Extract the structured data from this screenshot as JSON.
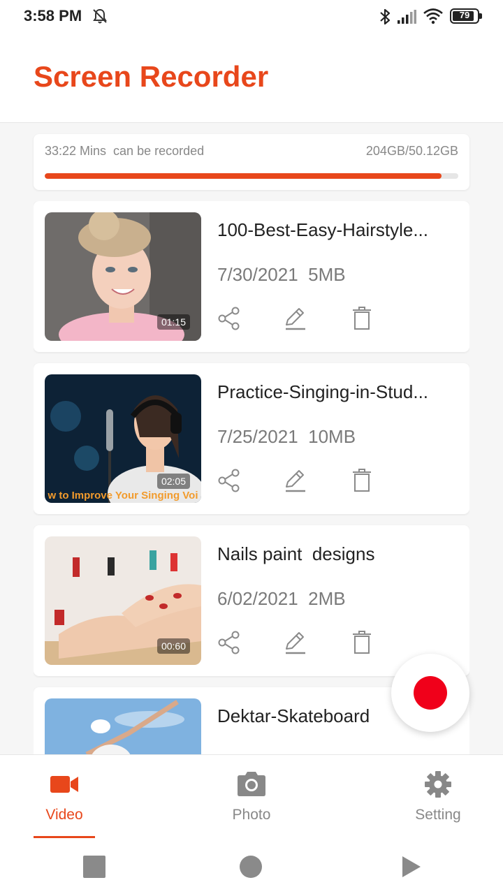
{
  "status_bar": {
    "time": "3:58 PM",
    "battery": "79",
    "icons": [
      "mute-icon",
      "bluetooth-icon",
      "signal-icon",
      "wifi-icon",
      "battery-icon"
    ]
  },
  "header": {
    "title": "Screen Recorder"
  },
  "storage": {
    "remaining": "33:22 Mins  can be recorded",
    "usage": "204GB/50.12GB",
    "progress_fraction": 0.96,
    "accent": "#e8471b"
  },
  "recordings": [
    {
      "title": "100-Best-Easy-Hairstyle...",
      "meta": "7/30/2021  5MB",
      "duration": "01:15",
      "caption": ""
    },
    {
      "title": "Practice-Singing-in-Stud...",
      "meta": "7/25/2021  10MB",
      "duration": "02:05",
      "caption": "w to Improve Your Singing Voi"
    },
    {
      "title": "Nails paint  designs",
      "meta": "6/02/2021  2MB",
      "duration": "00:60",
      "caption": ""
    },
    {
      "title": "Dektar-Skateboard",
      "meta": "",
      "duration": "",
      "caption": ""
    }
  ],
  "actions": [
    "share-icon",
    "edit-icon",
    "delete-icon"
  ],
  "fab": {
    "icon": "record-icon",
    "color": "#f0001a"
  },
  "bottom_nav": {
    "items": [
      {
        "label": "Video",
        "icon": "video-camera-icon",
        "active": true
      },
      {
        "label": "Photo",
        "icon": "photo-camera-icon",
        "active": false
      },
      {
        "label": "Setting",
        "icon": "gear-icon",
        "active": false
      }
    ]
  },
  "system_nav": [
    "recents-button",
    "home-button",
    "back-button"
  ]
}
